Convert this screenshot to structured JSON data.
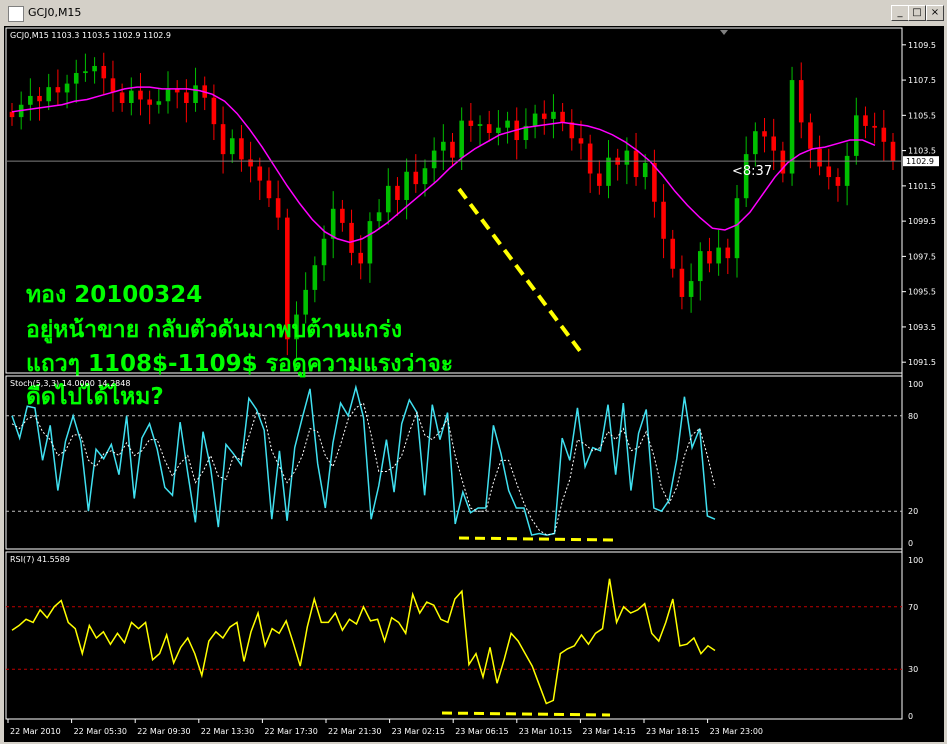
{
  "window": {
    "title": "GCJ0,M15",
    "min_label": "_",
    "max_label": "□",
    "close_label": "×"
  },
  "colors": {
    "up_candle": "#00c000",
    "down_candle": "#ff0000",
    "ma": "#ff00ff",
    "stoch_main": "#40e0f0",
    "stoch_signal": "#ffffff",
    "rsi": "#ffff00",
    "annotation": "#00ff00",
    "dashes": "#ffff00"
  },
  "chart_data": [
    {
      "type": "candlestick",
      "header": "GCJ0,M15  1103.3 1103.5 1102.9 1102.9",
      "y_ticks": [
        "1109.5",
        "1107.5",
        "1105.5",
        "1103.5",
        "1101.5",
        "1099.5",
        "1097.5",
        "1095.5",
        "1093.5",
        "1091.5"
      ],
      "ylim": [
        1091.0,
        1110.0
      ],
      "current_price": "1102.9",
      "countdown": "<8:37",
      "close": [
        1105.4,
        1106.1,
        1106.6,
        1106.3,
        1107.1,
        1106.8,
        1107.3,
        1107.9,
        1108.0,
        1108.3,
        1107.6,
        1106.8,
        1106.2,
        1106.9,
        1106.4,
        1106.1,
        1106.3,
        1107.0,
        1106.8,
        1106.2,
        1107.2,
        1106.5,
        1105.0,
        1103.3,
        1104.2,
        1103.0,
        1102.6,
        1101.8,
        1100.8,
        1099.7,
        1092.8,
        1094.2,
        1095.6,
        1097.0,
        1098.5,
        1100.2,
        1099.4,
        1097.7,
        1097.1,
        1099.5,
        1100.0,
        1101.5,
        1100.7,
        1102.3,
        1101.6,
        1102.5,
        1103.5,
        1104.0,
        1103.1,
        1105.2,
        1104.9,
        1105.0,
        1104.5,
        1104.8,
        1105.2,
        1104.1,
        1104.9,
        1105.6,
        1105.3,
        1105.7,
        1105.1,
        1104.2,
        1103.9,
        1102.2,
        1101.5,
        1103.1,
        1102.7,
        1103.5,
        1102.0,
        1102.8,
        1100.6,
        1098.5,
        1096.8,
        1095.2,
        1096.1,
        1097.8,
        1097.1,
        1098.0,
        1097.4,
        1100.8,
        1103.3,
        1104.6,
        1104.3,
        1103.5,
        1102.2,
        1107.5,
        1105.1,
        1103.6,
        1102.6,
        1102.0,
        1101.5,
        1103.2,
        1105.5,
        1104.9,
        1104.8,
        1104.0,
        1102.9
      ],
      "ma": [
        1105.7,
        1105.8,
        1105.9,
        1106.0,
        1106.1,
        1106.3,
        1106.4,
        1106.6,
        1106.8,
        1107.0,
        1107.1,
        1107.1,
        1107.0,
        1107.0,
        1107.0,
        1106.9,
        1106.7,
        1106.3,
        1105.6,
        1104.7,
        1103.7,
        1102.6,
        1101.5,
        1100.5,
        1099.6,
        1098.9,
        1098.5,
        1098.3,
        1098.5,
        1098.9,
        1099.4,
        1100.0,
        1100.6,
        1101.2,
        1101.8,
        1102.5,
        1103.1,
        1103.6,
        1104.0,
        1104.4,
        1104.6,
        1104.8,
        1104.9,
        1105.0,
        1105.1,
        1105.0,
        1104.9,
        1104.7,
        1104.4,
        1104.0,
        1103.5,
        1102.9,
        1102.1,
        1101.2,
        1100.4,
        1099.7,
        1099.1,
        1099.0,
        1099.3,
        1100.0,
        1101.0,
        1102.0,
        1102.8,
        1103.3,
        1103.6,
        1103.7,
        1103.9,
        1104.1,
        1104.1,
        1103.8
      ]
    },
    {
      "type": "line",
      "header": "Stoch(5,3,3) 14.0000 14.2848",
      "y_ticks": [
        "100",
        "80",
        "20",
        "0"
      ],
      "ylim": [
        0,
        100
      ],
      "levels": [
        80,
        20
      ],
      "series": [
        {
          "values": [
            80,
            66,
            86,
            85,
            52,
            74,
            33,
            64,
            80,
            64,
            20,
            59,
            53,
            62,
            43,
            80,
            28,
            66,
            75,
            59,
            35,
            30,
            76,
            44,
            13,
            70,
            47,
            10,
            62,
            56,
            49,
            91,
            84,
            71,
            15,
            58,
            14,
            60,
            79,
            97,
            50,
            22,
            63,
            88,
            80,
            98,
            79,
            15,
            36,
            65,
            32,
            75,
            90,
            82,
            30,
            87,
            65,
            82,
            12,
            32,
            19,
            22,
            22,
            74,
            56,
            33,
            22,
            22,
            5,
            6,
            5,
            6,
            66,
            52,
            85,
            48,
            60,
            58,
            87,
            43,
            88,
            33,
            69,
            84,
            22,
            20,
            27,
            53,
            92,
            60,
            72,
            17,
            15
          ]
        },
        {
          "values": [
            75,
            72,
            78,
            80,
            70,
            65,
            55,
            58,
            68,
            68,
            52,
            48,
            56,
            58,
            55,
            63,
            55,
            58,
            65,
            65,
            52,
            42,
            50,
            55,
            38,
            45,
            55,
            42,
            40,
            55,
            52,
            67,
            82,
            80,
            58,
            48,
            38,
            45,
            55,
            72,
            70,
            55,
            48,
            62,
            78,
            85,
            88,
            68,
            45,
            45,
            48,
            55,
            70,
            82,
            68,
            65,
            70,
            78,
            55,
            38,
            22,
            20,
            20,
            38,
            52,
            52,
            38,
            25,
            15,
            8,
            5,
            6,
            26,
            40,
            65,
            62,
            58,
            60,
            70,
            65,
            72,
            58,
            60,
            70,
            55,
            35,
            25,
            35,
            55,
            68,
            72,
            55,
            35
          ]
        }
      ]
    },
    {
      "type": "line",
      "header": "RSI(7) 41.5589",
      "y_ticks": [
        "100",
        "70",
        "30",
        "0"
      ],
      "ylim": [
        0,
        100
      ],
      "levels": [
        70,
        30
      ],
      "series": [
        {
          "values": [
            55,
            58,
            62,
            60,
            68,
            63,
            70,
            74,
            60,
            56,
            40,
            58,
            50,
            54,
            46,
            53,
            47,
            60,
            56,
            60,
            36,
            40,
            52,
            34,
            44,
            50,
            40,
            26,
            48,
            54,
            50,
            57,
            60,
            35,
            54,
            66,
            45,
            56,
            53,
            61,
            47,
            32,
            57,
            75,
            60,
            60,
            66,
            55,
            62,
            59,
            70,
            61,
            62,
            48,
            63,
            60,
            53,
            78,
            66,
            73,
            71,
            62,
            60,
            75,
            80,
            33,
            40,
            25,
            44,
            21,
            36,
            53,
            48,
            40,
            32,
            20,
            8,
            10,
            40,
            43,
            45,
            52,
            46,
            53,
            56,
            88,
            60,
            70,
            66,
            68,
            72,
            53,
            48,
            60,
            75,
            45,
            46,
            50,
            40,
            45,
            42
          ]
        }
      ]
    }
  ],
  "x_labels": [
    "22 Mar 2010",
    "22 Mar 05:30",
    "22 Mar 09:30",
    "22 Mar 13:30",
    "22 Mar 17:30",
    "22 Mar 21:30",
    "23 Mar 02:15",
    "23 Mar 06:15",
    "23 Mar 10:15",
    "23 Mar 14:15",
    "23 Mar 18:15",
    "23 Mar 23:00"
  ],
  "annotation": {
    "line1": "ทอง 20100324",
    "line2": "อยู่หน้าขาย  กลับตัวดันมาพบต้านแกร่ง",
    "line3": "แถวๆ 1108$-1109$  รอดูความแรงว่าจะ",
    "line4": "ดีดไปได้ไหม?"
  }
}
